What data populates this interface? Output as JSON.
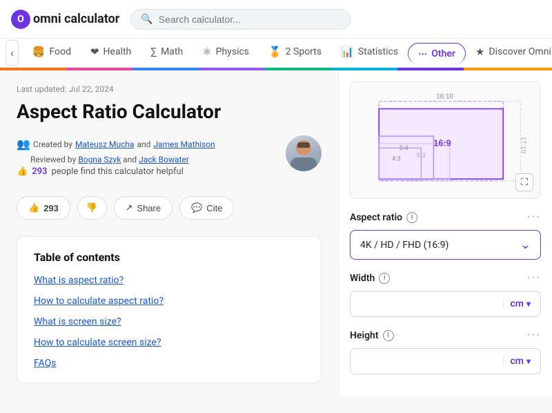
{
  "header": {
    "logo_text": "omni calculator",
    "search_placeholder": "Search calculator..."
  },
  "nav": {
    "arrow_back": "‹",
    "tabs": [
      {
        "id": "food",
        "label": "Food",
        "icon": "🍔",
        "active": false
      },
      {
        "id": "health",
        "label": "Health",
        "icon": "❤",
        "active": false
      },
      {
        "id": "math",
        "label": "Math",
        "icon": "∑",
        "active": false
      },
      {
        "id": "physics",
        "label": "Physics",
        "icon": "⚛",
        "active": false
      },
      {
        "id": "sports",
        "label": "2 Sports",
        "icon": "🏅",
        "active": false
      },
      {
        "id": "statistics",
        "label": "Statistics",
        "icon": "📊",
        "active": false
      },
      {
        "id": "other",
        "label": "Other",
        "icon": "···",
        "active": true
      },
      {
        "id": "discover",
        "label": "Discover Omni",
        "icon": "★",
        "active": false
      }
    ]
  },
  "page": {
    "last_updated": "Last updated: Jul 22, 2024",
    "title": "Aspect Ratio Calculator",
    "created_by_label": "Created by",
    "author1": "Mateusz Mucha",
    "and1": "and",
    "author2": "James Mathison",
    "reviewed_by_label": "Reviewed by",
    "author3": "Bogna Szyk",
    "and2": "and",
    "author4": "Jack Bowater",
    "helpful_text": "people find this calculator helpful",
    "helpful_count": "293",
    "like_count": "293"
  },
  "buttons": {
    "like": "293",
    "share": "Share",
    "cite": "Cite"
  },
  "toc": {
    "title": "Table of contents",
    "items": [
      "What is aspect ratio?",
      "How to calculate aspect ratio?",
      "What is screen size?",
      "How to calculate screen size?",
      "FAQs"
    ]
  },
  "calculator": {
    "aspect_ratio_label": "Aspect ratio",
    "aspect_ratio_value": "4K / HD / FHD (16:9)",
    "width_label": "Width",
    "width_unit": "cm",
    "height_label": "Height",
    "height_unit": "cm",
    "more_icon": "···",
    "info_icon": "i",
    "fullscreen_icon": "⛶",
    "expand_icon": "⌄"
  },
  "diagram": {
    "label_16_10": "16:10",
    "label_17_10": "17:10",
    "label_16_9": "16:9",
    "label_5_4": "5:4",
    "label_4_3": "4:3",
    "label_5_3": "5:3"
  }
}
